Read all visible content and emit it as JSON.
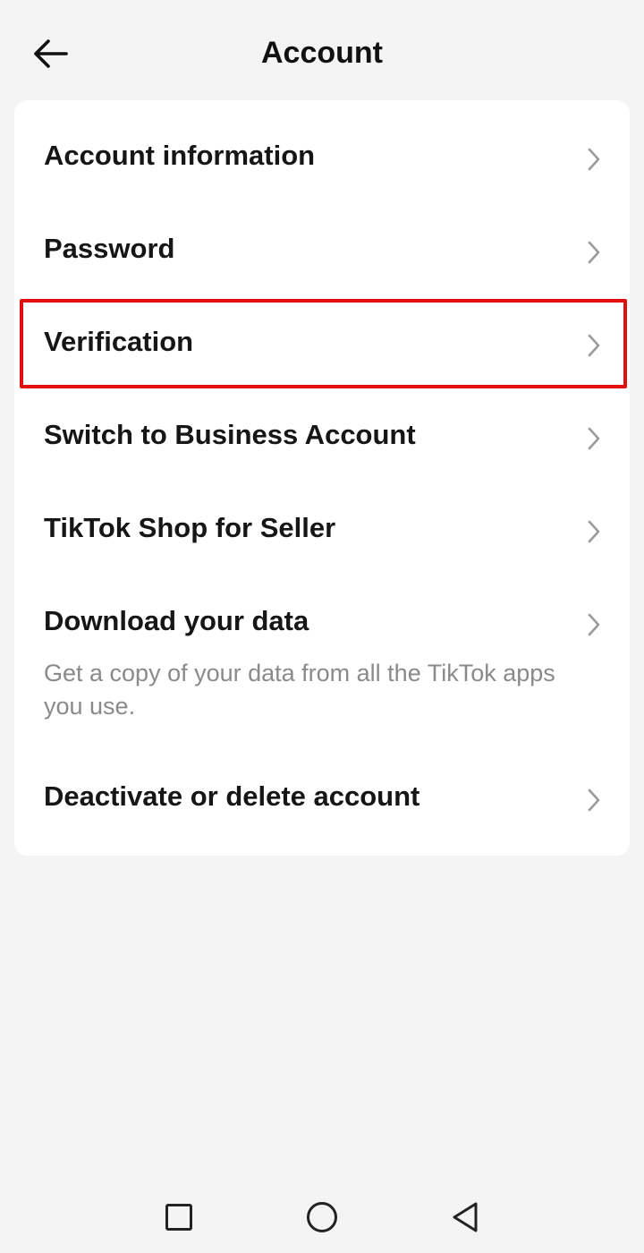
{
  "header": {
    "title": "Account",
    "back_icon": "arrow-left-icon"
  },
  "menu": {
    "items": [
      {
        "label": "Account information",
        "icon": "chevron-right-icon"
      },
      {
        "label": "Password",
        "icon": "chevron-right-icon"
      },
      {
        "label": "Verification",
        "icon": "chevron-right-icon",
        "highlighted": true
      },
      {
        "label": "Switch to Business Account",
        "icon": "chevron-right-icon"
      },
      {
        "label": "TikTok Shop for Seller",
        "icon": "chevron-right-icon"
      },
      {
        "label": "Download your data",
        "description": "Get a copy of your data from all the TikTok apps you use.",
        "icon": "chevron-right-icon"
      },
      {
        "label": "Deactivate or delete account",
        "icon": "chevron-right-icon"
      }
    ]
  },
  "navbar": {
    "buttons": [
      "recent-apps-icon",
      "home-icon",
      "back-triangle-icon"
    ]
  },
  "colors": {
    "background": "#f4f4f4",
    "card": "#ffffff",
    "highlight": "#e01010",
    "chevron": "#9a9a9a",
    "description_text": "#8a8a8a"
  }
}
